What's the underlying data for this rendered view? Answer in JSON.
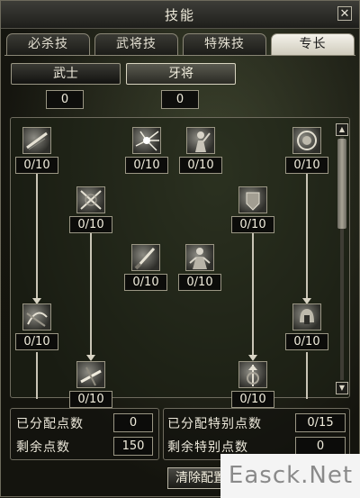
{
  "window": {
    "title": "技能",
    "close_glyph": "✕"
  },
  "tabs": [
    {
      "label": "必杀技",
      "active": false
    },
    {
      "label": "武将技",
      "active": false
    },
    {
      "label": "特殊技",
      "active": false
    },
    {
      "label": "专长",
      "active": true
    }
  ],
  "categories": [
    {
      "label": "武士",
      "points": "0"
    },
    {
      "label": "牙将",
      "points": "0"
    }
  ],
  "skills": [
    {
      "level": "0/10",
      "icon": "slash-skill-icon"
    },
    {
      "level": "0/10",
      "icon": "burst-skill-icon"
    },
    {
      "level": "0/10",
      "icon": "warrior-pose-skill-icon"
    },
    {
      "level": "0/10",
      "icon": "medallion-skill-icon"
    },
    {
      "level": "0/10",
      "icon": "crossed-swords-skill-icon"
    },
    {
      "level": "0/10",
      "icon": "armor-skill-icon"
    },
    {
      "level": "0/10",
      "icon": "blade-skill-icon"
    },
    {
      "level": "0/10",
      "icon": "stance-skill-icon"
    },
    {
      "level": "0/10",
      "icon": "whirlwind-skill-icon"
    },
    {
      "level": "0/10",
      "icon": "helmet-skill-icon"
    },
    {
      "level": "0/10",
      "icon": "strike-skill-icon"
    },
    {
      "level": "0/10",
      "icon": "spear-skill-icon"
    }
  ],
  "stats": {
    "allocated_label": "已分配点数",
    "allocated_value": "0",
    "remaining_label": "剩余点数",
    "remaining_value": "150",
    "special_allocated_label": "已分配特别点数",
    "special_allocated_value": "0/15",
    "special_remaining_label": "剩余特别点数",
    "special_remaining_value": "0"
  },
  "clear_button": "清除配置",
  "watermark": "Easck.Net"
}
